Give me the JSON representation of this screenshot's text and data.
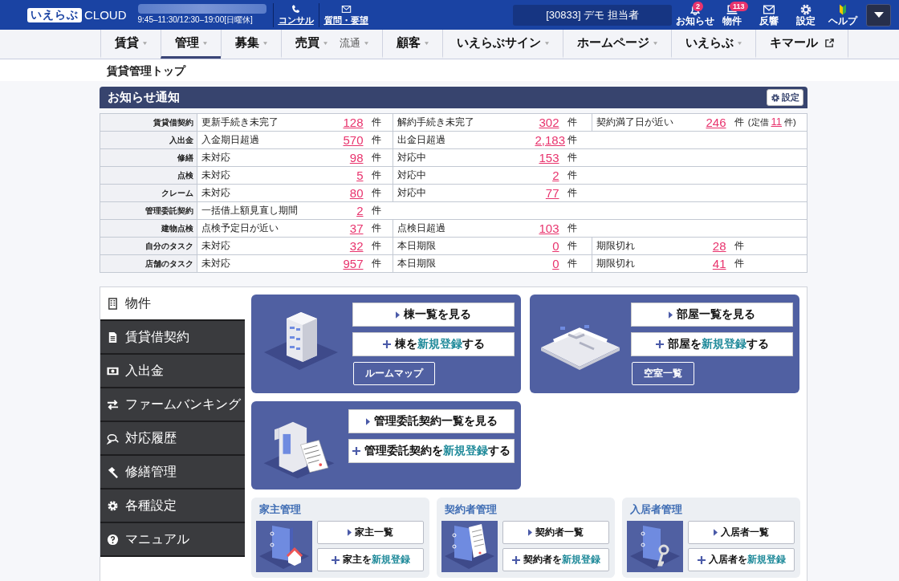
{
  "header": {
    "logo": "いえらぶ",
    "logo_suffix": "CLOUD",
    "hours": "9:45–11:30/12:30–19:00[日曜休]",
    "links": [
      {
        "kind": "phone",
        "label": "コンサル"
      },
      {
        "kind": "mail",
        "label": "質問・要望"
      }
    ],
    "user": "[30833] デモ 担当者",
    "icons": [
      {
        "kind": "bell",
        "label": "お知らせ",
        "badge": "2"
      },
      {
        "kind": "laptop",
        "label": "物件",
        "badge": "113"
      },
      {
        "kind": "mail",
        "label": "反響"
      },
      {
        "kind": "gear",
        "label": "設定"
      },
      {
        "kind": "leaf",
        "label": "ヘルプ"
      }
    ]
  },
  "nav": [
    {
      "label": "賃貸",
      "kind": "menu",
      "selected": false
    },
    {
      "label": "管理",
      "kind": "menu",
      "selected": true
    },
    {
      "label": "募集",
      "kind": "menu",
      "selected": false
    },
    {
      "label": "売買",
      "kind": "menu",
      "sub": "流通",
      "selected": false
    },
    {
      "label": "顧客",
      "kind": "menu",
      "selected": false
    },
    {
      "label": "いえらぶサイン",
      "kind": "menu",
      "selected": false
    },
    {
      "label": "ホームページ",
      "kind": "menu",
      "selected": false
    },
    {
      "label": "いえらぶ",
      "kind": "menu",
      "selected": false
    },
    {
      "label": "キマール",
      "kind": "external",
      "selected": false
    }
  ],
  "breadcrumb": "賃貸管理トップ",
  "notices": {
    "title": "お知らせ通知",
    "settings_button": "設定",
    "rows": [
      {
        "label": "賃貸借契約",
        "items": [
          {
            "text": "更新手続き未完了",
            "count": "128",
            "unit": "件"
          },
          {
            "text": "解約手続き未完了",
            "count": "302",
            "unit": "件"
          },
          {
            "text": "契約満了日が近い",
            "count": "246",
            "unit": "件",
            "note": {
              "prefix": "(定借",
              "count": "11",
              "suffix": "件)"
            }
          }
        ]
      },
      {
        "label": "入出金",
        "items": [
          {
            "text": "入金期日超過",
            "count": "570",
            "unit": "件"
          },
          {
            "text": "出金日超過",
            "count": "2,183",
            "unit": "件"
          }
        ]
      },
      {
        "label": "修繕",
        "items": [
          {
            "text": "未対応",
            "count": "98",
            "unit": "件"
          },
          {
            "text": "対応中",
            "count": "153",
            "unit": "件"
          }
        ]
      },
      {
        "label": "点検",
        "items": [
          {
            "text": "未対応",
            "count": "5",
            "unit": "件"
          },
          {
            "text": "対応中",
            "count": "2",
            "unit": "件"
          }
        ]
      },
      {
        "label": "クレーム",
        "items": [
          {
            "text": "未対応",
            "count": "80",
            "unit": "件"
          },
          {
            "text": "対応中",
            "count": "77",
            "unit": "件"
          }
        ]
      },
      {
        "label": "管理委託契約",
        "items": [
          {
            "text": "一括借上額見直し期間",
            "count": "2",
            "unit": "件"
          }
        ]
      },
      {
        "label": "建物点検",
        "items": [
          {
            "text": "点検予定日が近い",
            "count": "37",
            "unit": "件"
          },
          {
            "text": "点検日超過",
            "count": "103",
            "unit": "件"
          }
        ]
      },
      {
        "label": "自分のタスク",
        "items": [
          {
            "text": "未対応",
            "count": "32",
            "unit": "件"
          },
          {
            "text": "本日期限",
            "count": "0",
            "unit": "件"
          },
          {
            "text": "期限切れ",
            "count": "28",
            "unit": "件"
          }
        ]
      },
      {
        "label": "店舗のタスク",
        "items": [
          {
            "text": "未対応",
            "count": "957",
            "unit": "件"
          },
          {
            "text": "本日期限",
            "count": "0",
            "unit": "件"
          },
          {
            "text": "期限切れ",
            "count": "41",
            "unit": "件"
          }
        ]
      }
    ]
  },
  "sidebar": {
    "items": [
      {
        "label": "物件",
        "selected": true
      },
      {
        "label": "賃貸借契約",
        "selected": false
      },
      {
        "label": "入出金",
        "selected": false
      },
      {
        "label": "ファームバンキング",
        "selected": false
      },
      {
        "label": "対応履歴",
        "selected": false
      },
      {
        "label": "修繕管理",
        "selected": false
      },
      {
        "label": "各種設定",
        "selected": false
      },
      {
        "label": "マニュアル",
        "selected": false
      }
    ]
  },
  "cards": [
    {
      "buttons": [
        {
          "kind": "view",
          "text": "棟一覧を見る"
        },
        {
          "kind": "add",
          "before": "棟を",
          "highlight": "新規登録",
          "after": "する"
        }
      ],
      "small_button": "ルームマップ"
    },
    {
      "buttons": [
        {
          "kind": "view",
          "text": "部屋一覧を見る"
        },
        {
          "kind": "add",
          "before": "部屋を",
          "highlight": "新規登録",
          "after": "する"
        }
      ],
      "small_button": "空室一覧"
    },
    {
      "buttons": [
        {
          "kind": "view",
          "text": "管理委託契約一覧を見る"
        },
        {
          "kind": "add",
          "before": "管理委託契約を",
          "highlight": "新規登録",
          "after": "する"
        }
      ]
    }
  ],
  "people": [
    {
      "title": "家主管理",
      "buttons": [
        {
          "kind": "view",
          "text": "家主一覧"
        },
        {
          "kind": "add",
          "before": "家主を",
          "highlight": "新規登録"
        }
      ]
    },
    {
      "title": "契約者管理",
      "buttons": [
        {
          "kind": "view",
          "text": "契約者一覧"
        },
        {
          "kind": "add",
          "before": "契約者を",
          "highlight": "新規登録"
        }
      ]
    },
    {
      "title": "入居者管理",
      "buttons": [
        {
          "kind": "view",
          "text": "入居者一覧"
        },
        {
          "kind": "add",
          "before": "入居者を",
          "highlight": "新規登録"
        }
      ]
    }
  ]
}
